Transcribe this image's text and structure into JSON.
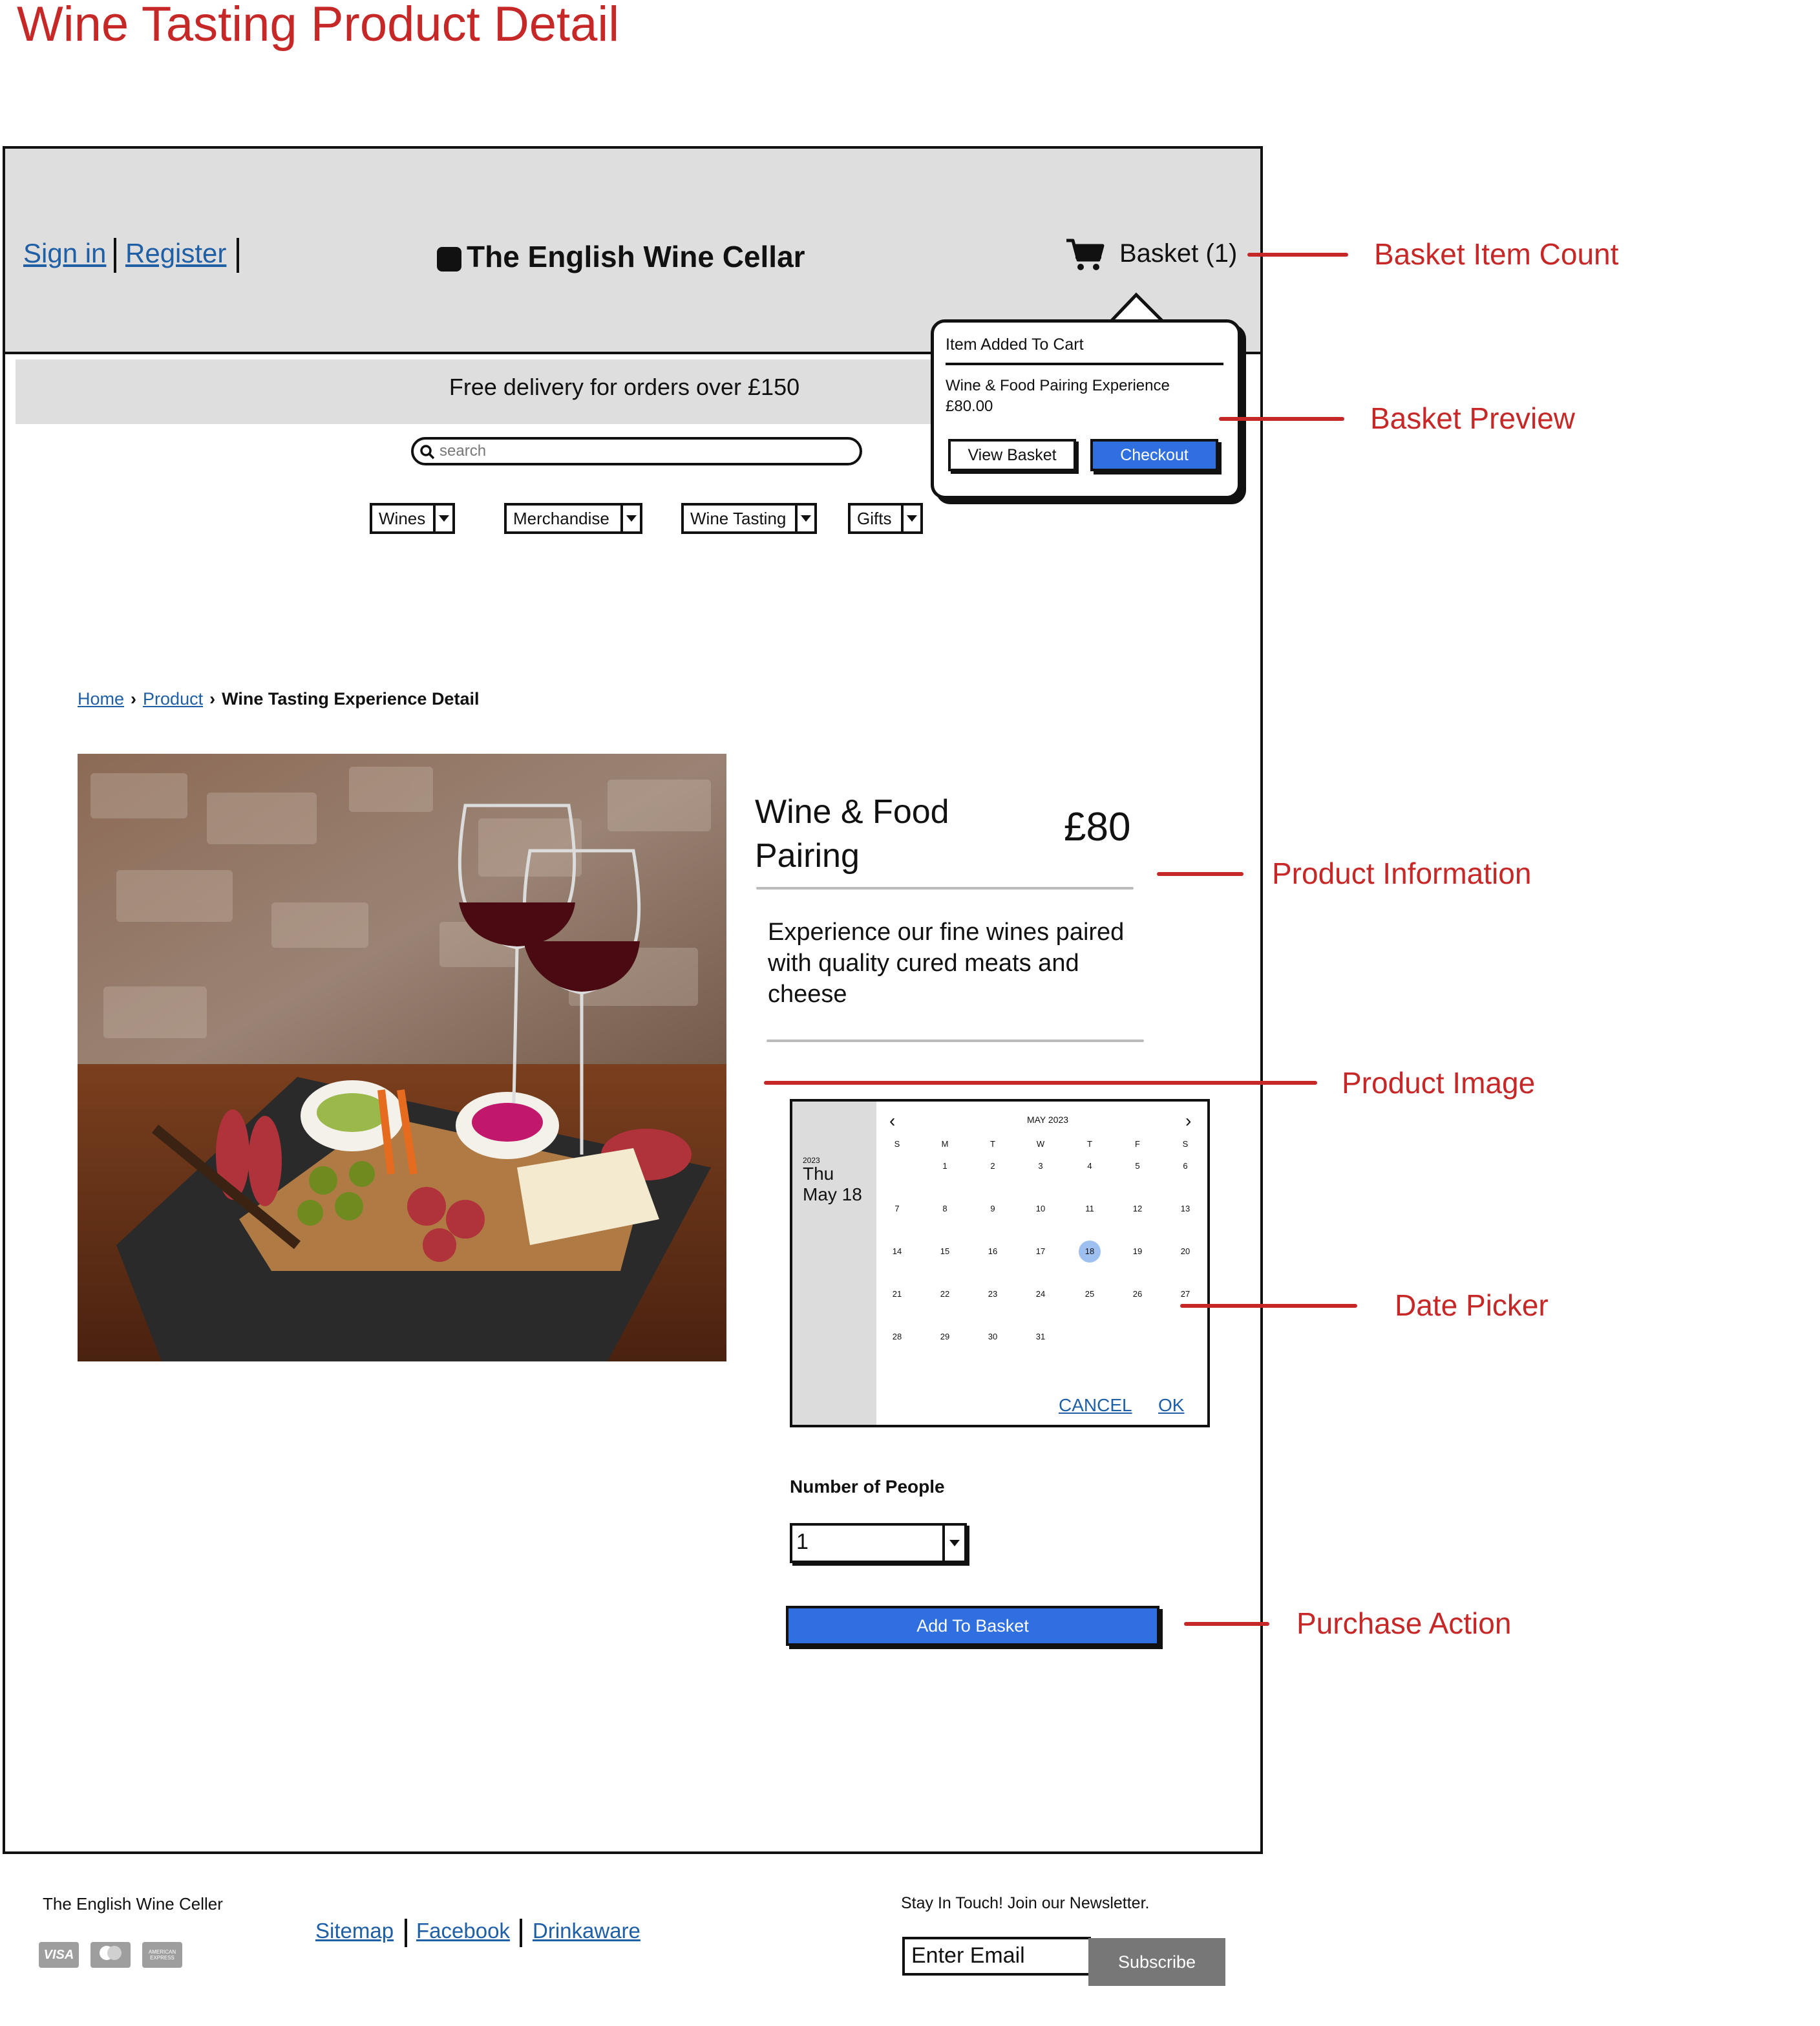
{
  "page_title": "Wine Tasting Product Detail",
  "header": {
    "sign_in": "Sign in",
    "register": "Register",
    "brand": "The English Wine Cellar",
    "basket_label": "Basket (1)"
  },
  "promo_banner": "Free delivery for orders over £150",
  "search": {
    "placeholder": "search"
  },
  "nav_menus": [
    "Wines",
    "Merchandise",
    "Wine Tasting",
    "Gifts"
  ],
  "basket_preview": {
    "title": "Item Added To Cart",
    "item_name": "Wine & Food Pairing Experience",
    "item_price": "£80.00",
    "view_basket": "View Basket",
    "checkout": "Checkout"
  },
  "breadcrumb": {
    "home": "Home",
    "product": "Product",
    "current": "Wine Tasting Experience Detail"
  },
  "product": {
    "title_line1": "Wine & Food",
    "title_line2": "Pairing",
    "price": "£80",
    "desc_line1": "Experience our fine wines paired",
    "desc_line2": "with quality cured meats and",
    "desc_line3": "cheese"
  },
  "date_picker": {
    "year": "2023",
    "day": "Thu",
    "date": "May 18",
    "month_label": "MAY 2023",
    "weekdays": [
      "S",
      "M",
      "T",
      "W",
      "T",
      "F",
      "S"
    ],
    "selected_day": 18,
    "cancel": "CANCEL",
    "ok": "OK"
  },
  "people": {
    "label": "Number of People",
    "value": "1"
  },
  "add_to_basket": "Add To Basket",
  "footer": {
    "company": "The English Wine Celler",
    "links": [
      "Sitemap",
      "Facebook",
      "Drinkaware"
    ],
    "newsletter_text": "Stay In Touch! Join our Newsletter.",
    "email_placeholder": "Enter Email",
    "subscribe": "Subscribe",
    "payment_cards": [
      "VISA",
      "mastercard",
      "AMERICAN EXPRESS"
    ]
  },
  "annotations": {
    "basket_count": "Basket Item Count",
    "basket_preview": "Basket Preview",
    "product_info": "Product Information",
    "product_image": "Product Image",
    "date_picker": "Date Picker",
    "purchase_action": "Purchase Action"
  },
  "colors": {
    "annotation": "#c62828",
    "link": "#1f5fa6",
    "primary_button": "#2f6fe0",
    "header_bg": "#dedede"
  }
}
